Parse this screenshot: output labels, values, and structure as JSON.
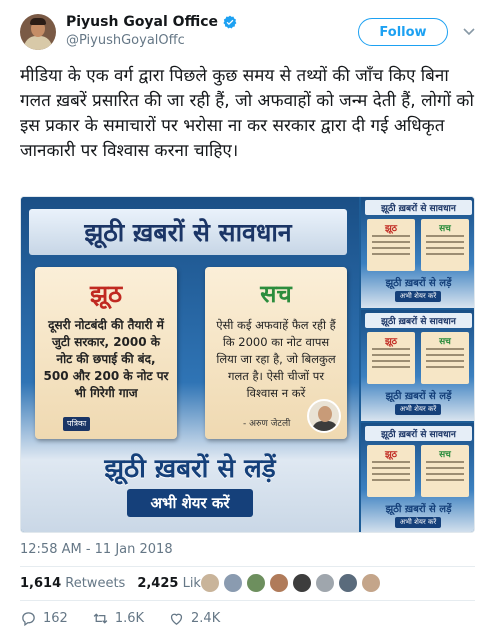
{
  "author": {
    "display_name": "Piyush Goyal Office",
    "handle": "@PiyushGoyalOffc"
  },
  "follow_label": "Follow",
  "tweet_text": "मीडिया के एक वर्ग द्वारा पिछले कुछ समय से तथ्यों की जाँच किए बिना गलत ख़बरें प्रसारित की जा रही हैं, जो अफवाहों को जन्म देती हैं, लोगों को इस प्रकार के समाचारों पर भरोसा ना कर सरकार द्वारा दी गई अधिकृत जानकारी पर विश्वास करना चाहिए।",
  "media": {
    "headline": "झूठी ख़बरों से सावधान",
    "jhooth_title": "झूठ",
    "jhooth_text": "दूसरी नोटबंदी की तैयारी में जुटी सरकार, 2000 के नोट की छपाई की बंद, 500 और 200 के नोट पर भी गिरेगी गाज",
    "source_label": "पत्रिका",
    "sach_title": "सच",
    "sach_text": "ऐसी कई अफवाहें फैल रही हैं कि 2000 का नोट वापस लिया जा रहा है, जो बिलकुल गलत है। ऐसी चीजों पर विश्वास न करें",
    "quote_attribution": "- अरुण जेटली",
    "cta_main": "झूठी ख़बरों से लड़ें",
    "cta_sub": "अभी शेयर करें",
    "thumbnails": [
      {
        "headline": "झूठी ख़बरों से सावधान",
        "left_title": "झूठ",
        "right_title": "सच",
        "cta": "झूठी ख़बरों से लड़ें",
        "sub": "अभी शेयर करें"
      },
      {
        "headline": "झूठी ख़बरों से सावधान",
        "left_title": "झूठ",
        "right_title": "सच",
        "cta": "झूठी ख़बरों से लड़ें",
        "sub": "अभी शेयर करें"
      },
      {
        "headline": "झूठी ख़बरों से सावधान",
        "left_title": "झूठ",
        "right_title": "सच",
        "cta": "झूठी ख़बरों से लड़ें",
        "sub": "अभी शेयर करें"
      }
    ]
  },
  "timestamp": "12:58 AM - 11 Jan 2018",
  "stats": {
    "retweets_count": "1,614",
    "retweets_label": "Retweets",
    "likes_count": "2,425",
    "likes_label": "Likes"
  },
  "liker_colors": [
    "#c9b49a",
    "#8a9bb0",
    "#6d8f5e",
    "#b07b5a",
    "#3d3d3d",
    "#9fa6ad",
    "#5a6b7c",
    "#c4a58a"
  ],
  "actions": {
    "reply_count": "162",
    "retweet_count": "1.6K",
    "like_count": "2.4K"
  },
  "colors": {
    "accent": "#1da1f2",
    "text_secondary": "#657786"
  }
}
